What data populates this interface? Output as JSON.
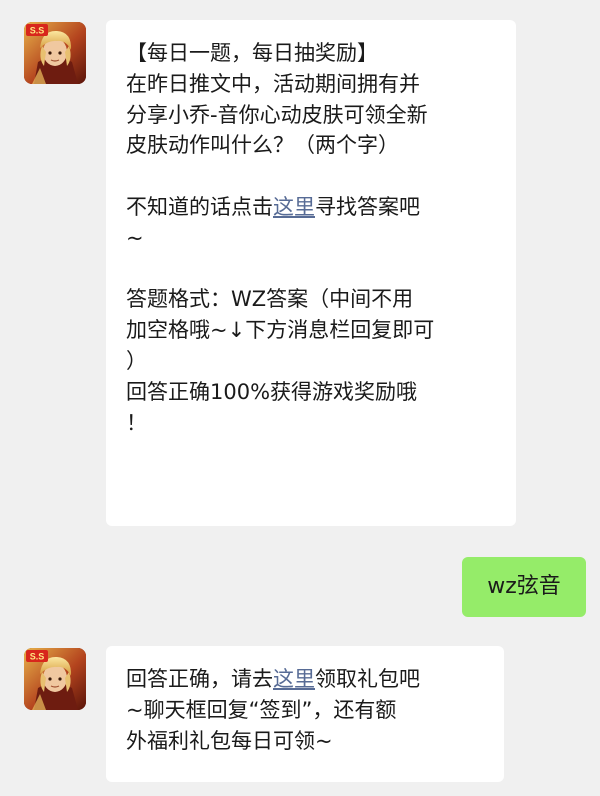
{
  "chat": {
    "messages": [
      {
        "sender": "game-account",
        "avatar": {
          "icon": "hero-avatar-icon",
          "badge": "S.S"
        },
        "lines": {
          "l1": "【每日一题，每日抽奖励】",
          "l2": "在昨日推文中，活动期间拥有并",
          "l3": "分享小乔-音你心动皮肤可领全新",
          "l4": "皮肤动作叫什么？（两个字）",
          "l5_before": "不知道的话点击",
          "l5_link": "这里",
          "l5_after": "寻找答案吧",
          "l6": "~",
          "l7": "答题格式：WZ答案（中间不用",
          "l8": "加空格哦~↓下方消息栏回复即可",
          "l9": "）",
          "l10": "回答正确100%获得游戏奖励哦",
          "l11": "！"
        }
      },
      {
        "sender": "user",
        "text": "wz弦音"
      },
      {
        "sender": "game-account",
        "avatar": {
          "icon": "hero-avatar-icon",
          "badge": "S.S"
        },
        "lines": {
          "l1_before": "回答正确，请去",
          "l1_link": "这里",
          "l1_after": "领取礼包吧",
          "l2": "~聊天框回复“签到”，还有额",
          "l3": "外福利礼包每日可领~"
        }
      }
    ]
  },
  "colors": {
    "background": "#f0f0f0",
    "incoming_bubble": "#ffffff",
    "outgoing_bubble": "#95ec69",
    "link": "#576b95"
  }
}
